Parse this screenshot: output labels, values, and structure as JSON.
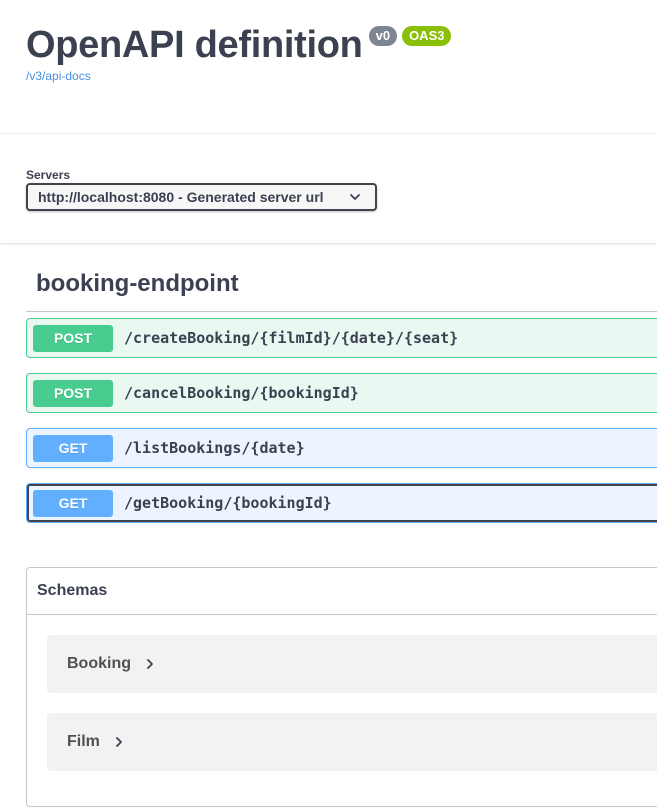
{
  "info": {
    "title": "OpenAPI definition",
    "version_badge": "v0",
    "oas_badge": "OAS3",
    "spec_link": "/v3/api-docs"
  },
  "servers": {
    "label": "Servers",
    "selected": "http://localhost:8080 - Generated server url"
  },
  "tag": {
    "name": "booking-endpoint"
  },
  "operations": [
    {
      "method": "POST",
      "path": "/createBooking/{filmId}/{date}/{seat}"
    },
    {
      "method": "POST",
      "path": "/cancelBooking/{bookingId}"
    },
    {
      "method": "GET",
      "path": "/listBookings/{date}"
    },
    {
      "method": "GET",
      "path": "/getBooking/{bookingId}"
    }
  ],
  "schemas": {
    "title": "Schemas",
    "items": [
      {
        "name": "Booking"
      },
      {
        "name": "Film"
      }
    ]
  },
  "colors": {
    "post": "#49cc90",
    "get": "#61affe",
    "link": "#4990e2",
    "oas_badge": "#89bf04",
    "version_badge": "#7d8492"
  },
  "icons": {
    "select": "chevron-down-icon",
    "model": "chevron-right-icon"
  }
}
